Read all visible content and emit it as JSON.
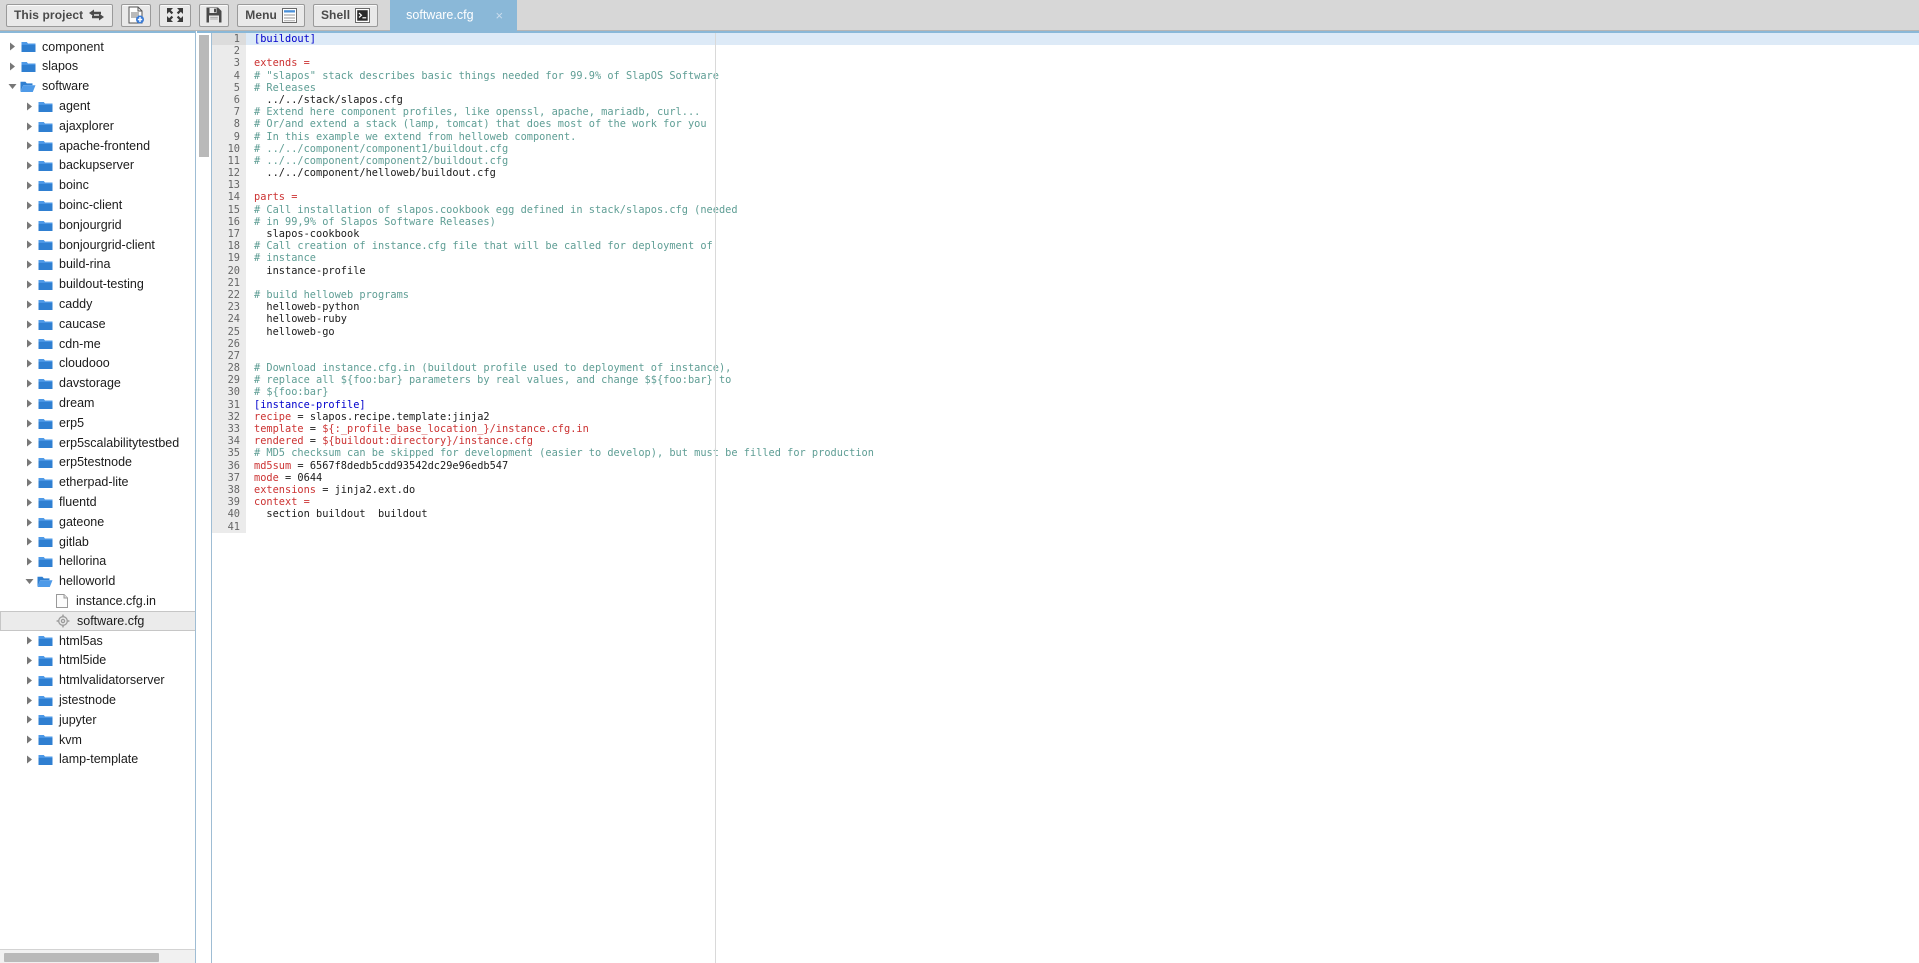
{
  "toolbar": {
    "project_button": "This project",
    "project_icon": "left-right-arrows-icon",
    "new_file_button_icon": "new-file-icon",
    "fullscreen_button_icon": "collapse-arrows-icon",
    "save_button_icon": "floppy-disk-save-icon",
    "menu_button": "Menu",
    "menu_icon": "list-lines-icon",
    "shell_button": "Shell",
    "shell_icon": "terminal-icon"
  },
  "tabs": [
    {
      "label": "software.cfg",
      "close": "×",
      "active": true
    }
  ],
  "sidebar": {
    "scrollbar": "horizontal-scrollbar",
    "tree": [
      {
        "label": "component",
        "depth": 0,
        "type": "folder",
        "state": "collapsed"
      },
      {
        "label": "slapos",
        "depth": 0,
        "type": "folder",
        "state": "collapsed"
      },
      {
        "label": "software",
        "depth": 0,
        "type": "folder",
        "state": "expanded"
      },
      {
        "label": "agent",
        "depth": 1,
        "type": "folder",
        "state": "collapsed"
      },
      {
        "label": "ajaxplorer",
        "depth": 1,
        "type": "folder",
        "state": "collapsed"
      },
      {
        "label": "apache-frontend",
        "depth": 1,
        "type": "folder",
        "state": "collapsed"
      },
      {
        "label": "backupserver",
        "depth": 1,
        "type": "folder",
        "state": "collapsed"
      },
      {
        "label": "boinc",
        "depth": 1,
        "type": "folder",
        "state": "collapsed"
      },
      {
        "label": "boinc-client",
        "depth": 1,
        "type": "folder",
        "state": "collapsed"
      },
      {
        "label": "bonjourgrid",
        "depth": 1,
        "type": "folder",
        "state": "collapsed"
      },
      {
        "label": "bonjourgrid-client",
        "depth": 1,
        "type": "folder",
        "state": "collapsed"
      },
      {
        "label": "build-rina",
        "depth": 1,
        "type": "folder",
        "state": "collapsed"
      },
      {
        "label": "buildout-testing",
        "depth": 1,
        "type": "folder",
        "state": "collapsed"
      },
      {
        "label": "caddy",
        "depth": 1,
        "type": "folder",
        "state": "collapsed"
      },
      {
        "label": "caucase",
        "depth": 1,
        "type": "folder",
        "state": "collapsed"
      },
      {
        "label": "cdn-me",
        "depth": 1,
        "type": "folder",
        "state": "collapsed"
      },
      {
        "label": "cloudooo",
        "depth": 1,
        "type": "folder",
        "state": "collapsed"
      },
      {
        "label": "davstorage",
        "depth": 1,
        "type": "folder",
        "state": "collapsed"
      },
      {
        "label": "dream",
        "depth": 1,
        "type": "folder",
        "state": "collapsed"
      },
      {
        "label": "erp5",
        "depth": 1,
        "type": "folder",
        "state": "collapsed"
      },
      {
        "label": "erp5scalabilitytestbed",
        "depth": 1,
        "type": "folder",
        "state": "collapsed"
      },
      {
        "label": "erp5testnode",
        "depth": 1,
        "type": "folder",
        "state": "collapsed"
      },
      {
        "label": "etherpad-lite",
        "depth": 1,
        "type": "folder",
        "state": "collapsed"
      },
      {
        "label": "fluentd",
        "depth": 1,
        "type": "folder",
        "state": "collapsed"
      },
      {
        "label": "gateone",
        "depth": 1,
        "type": "folder",
        "state": "collapsed"
      },
      {
        "label": "gitlab",
        "depth": 1,
        "type": "folder",
        "state": "collapsed"
      },
      {
        "label": "hellorina",
        "depth": 1,
        "type": "folder",
        "state": "collapsed"
      },
      {
        "label": "helloworld",
        "depth": 1,
        "type": "folder",
        "state": "expanded"
      },
      {
        "label": "instance.cfg.in",
        "depth": 2,
        "type": "file",
        "state": "none"
      },
      {
        "label": "software.cfg",
        "depth": 2,
        "type": "config",
        "state": "none",
        "selected": true
      },
      {
        "label": "html5as",
        "depth": 1,
        "type": "folder",
        "state": "collapsed"
      },
      {
        "label": "html5ide",
        "depth": 1,
        "type": "folder",
        "state": "collapsed"
      },
      {
        "label": "htmlvalidatorserver",
        "depth": 1,
        "type": "folder",
        "state": "collapsed"
      },
      {
        "label": "jstestnode",
        "depth": 1,
        "type": "folder",
        "state": "collapsed"
      },
      {
        "label": "jupyter",
        "depth": 1,
        "type": "folder",
        "state": "collapsed"
      },
      {
        "label": "kvm",
        "depth": 1,
        "type": "folder",
        "state": "collapsed"
      },
      {
        "label": "lamp-template",
        "depth": 1,
        "type": "folder",
        "state": "collapsed"
      }
    ]
  },
  "editor": {
    "filename": "software.cfg",
    "active_line": 1,
    "total_lines": 41,
    "lines": [
      {
        "n": 1,
        "tokens": [
          {
            "c": "sec",
            "t": "[buildout]"
          }
        ]
      },
      {
        "n": 2,
        "tokens": []
      },
      {
        "n": 3,
        "tokens": [
          {
            "c": "key",
            "t": "extends ="
          }
        ]
      },
      {
        "n": 4,
        "tokens": [
          {
            "c": "com",
            "t": "# \"slapos\" stack describes basic things needed for 99.9% of SlapOS Software"
          }
        ]
      },
      {
        "n": 5,
        "tokens": [
          {
            "c": "com",
            "t": "# Releases"
          }
        ]
      },
      {
        "n": 6,
        "tokens": [
          {
            "c": "val",
            "t": "  ../../stack/slapos.cfg"
          }
        ]
      },
      {
        "n": 7,
        "tokens": [
          {
            "c": "com",
            "t": "# Extend here component profiles, like openssl, apache, mariadb, curl..."
          }
        ]
      },
      {
        "n": 8,
        "tokens": [
          {
            "c": "com",
            "t": "# Or/and extend a stack (lamp, tomcat) that does most of the work for you"
          }
        ]
      },
      {
        "n": 9,
        "tokens": [
          {
            "c": "com",
            "t": "# In this example we extend from helloweb component."
          }
        ]
      },
      {
        "n": 10,
        "tokens": [
          {
            "c": "com",
            "t": "# ../../component/component1/buildout.cfg"
          }
        ]
      },
      {
        "n": 11,
        "tokens": [
          {
            "c": "com",
            "t": "# ../../component/component2/buildout.cfg"
          }
        ]
      },
      {
        "n": 12,
        "tokens": [
          {
            "c": "val",
            "t": "  ../../component/helloweb/buildout.cfg"
          }
        ]
      },
      {
        "n": 13,
        "tokens": []
      },
      {
        "n": 14,
        "tokens": [
          {
            "c": "key",
            "t": "parts ="
          }
        ]
      },
      {
        "n": 15,
        "tokens": [
          {
            "c": "com",
            "t": "# Call installation of slapos.cookbook egg defined in stack/slapos.cfg (needed"
          }
        ]
      },
      {
        "n": 16,
        "tokens": [
          {
            "c": "com",
            "t": "# in 99,9% of Slapos Software Releases)"
          }
        ]
      },
      {
        "n": 17,
        "tokens": [
          {
            "c": "val",
            "t": "  slapos-cookbook"
          }
        ]
      },
      {
        "n": 18,
        "tokens": [
          {
            "c": "com",
            "t": "# Call creation of instance.cfg file that will be called for deployment of"
          }
        ]
      },
      {
        "n": 19,
        "tokens": [
          {
            "c": "com",
            "t": "# instance"
          }
        ]
      },
      {
        "n": 20,
        "tokens": [
          {
            "c": "val",
            "t": "  instance-profile"
          }
        ]
      },
      {
        "n": 21,
        "tokens": []
      },
      {
        "n": 22,
        "tokens": [
          {
            "c": "com",
            "t": "# build helloweb programs"
          }
        ]
      },
      {
        "n": 23,
        "tokens": [
          {
            "c": "val",
            "t": "  helloweb-python"
          }
        ]
      },
      {
        "n": 24,
        "tokens": [
          {
            "c": "val",
            "t": "  helloweb-ruby"
          }
        ]
      },
      {
        "n": 25,
        "tokens": [
          {
            "c": "val",
            "t": "  helloweb-go"
          }
        ]
      },
      {
        "n": 26,
        "tokens": []
      },
      {
        "n": 27,
        "tokens": []
      },
      {
        "n": 28,
        "tokens": [
          {
            "c": "com",
            "t": "# Download instance.cfg.in (buildout profile used to deployment of instance),"
          }
        ]
      },
      {
        "n": 29,
        "tokens": [
          {
            "c": "com",
            "t": "# replace all ${foo:bar} parameters by real values, and change $${foo:bar} to"
          }
        ]
      },
      {
        "n": 30,
        "tokens": [
          {
            "c": "com",
            "t": "# ${foo:bar}"
          }
        ]
      },
      {
        "n": 31,
        "tokens": [
          {
            "c": "sec",
            "t": "[instance-profile]"
          }
        ]
      },
      {
        "n": 32,
        "tokens": [
          {
            "c": "key",
            "t": "recipe"
          },
          {
            "c": "op",
            "t": " = "
          },
          {
            "c": "val",
            "t": "slapos.recipe.template:jinja2"
          }
        ]
      },
      {
        "n": 33,
        "tokens": [
          {
            "c": "key",
            "t": "template"
          },
          {
            "c": "op",
            "t": " = "
          },
          {
            "c": "var",
            "t": "${:_profile_base_location_}/instance.cfg.in"
          }
        ]
      },
      {
        "n": 34,
        "tokens": [
          {
            "c": "key",
            "t": "rendered"
          },
          {
            "c": "op",
            "t": " = "
          },
          {
            "c": "var",
            "t": "${buildout:directory}/instance.cfg"
          }
        ]
      },
      {
        "n": 35,
        "tokens": [
          {
            "c": "com",
            "t": "# MD5 checksum can be skipped for development (easier to develop), but must be filled for production"
          }
        ]
      },
      {
        "n": 36,
        "tokens": [
          {
            "c": "key",
            "t": "md5sum"
          },
          {
            "c": "op",
            "t": " = "
          },
          {
            "c": "num",
            "t": "6567f8dedb5cdd93542dc29e96edb547"
          }
        ]
      },
      {
        "n": 37,
        "tokens": [
          {
            "c": "key",
            "t": "mode"
          },
          {
            "c": "op",
            "t": " = "
          },
          {
            "c": "num",
            "t": "0644"
          }
        ]
      },
      {
        "n": 38,
        "tokens": [
          {
            "c": "key",
            "t": "extensions"
          },
          {
            "c": "op",
            "t": " = "
          },
          {
            "c": "val",
            "t": "jinja2.ext.do"
          }
        ]
      },
      {
        "n": 39,
        "tokens": [
          {
            "c": "key",
            "t": "context ="
          }
        ]
      },
      {
        "n": 40,
        "tokens": [
          {
            "c": "val",
            "t": "  section buildout  buildout"
          }
        ]
      },
      {
        "n": 41,
        "tokens": []
      }
    ]
  },
  "colors": {
    "toolbar_bg": "#d7d7d7",
    "tab_active_bg": "#8ab8d8",
    "accent_rule": "#8ab8d8",
    "gutter_bg": "#ebebeb",
    "active_line_bg": "#ddeaf7",
    "folder_blue": "#3a7bd5",
    "section_token": "#0000cc",
    "key_token": "#cc3333",
    "comment_token": "#5f9e95",
    "selected_row_bg": "#ebebeb"
  }
}
